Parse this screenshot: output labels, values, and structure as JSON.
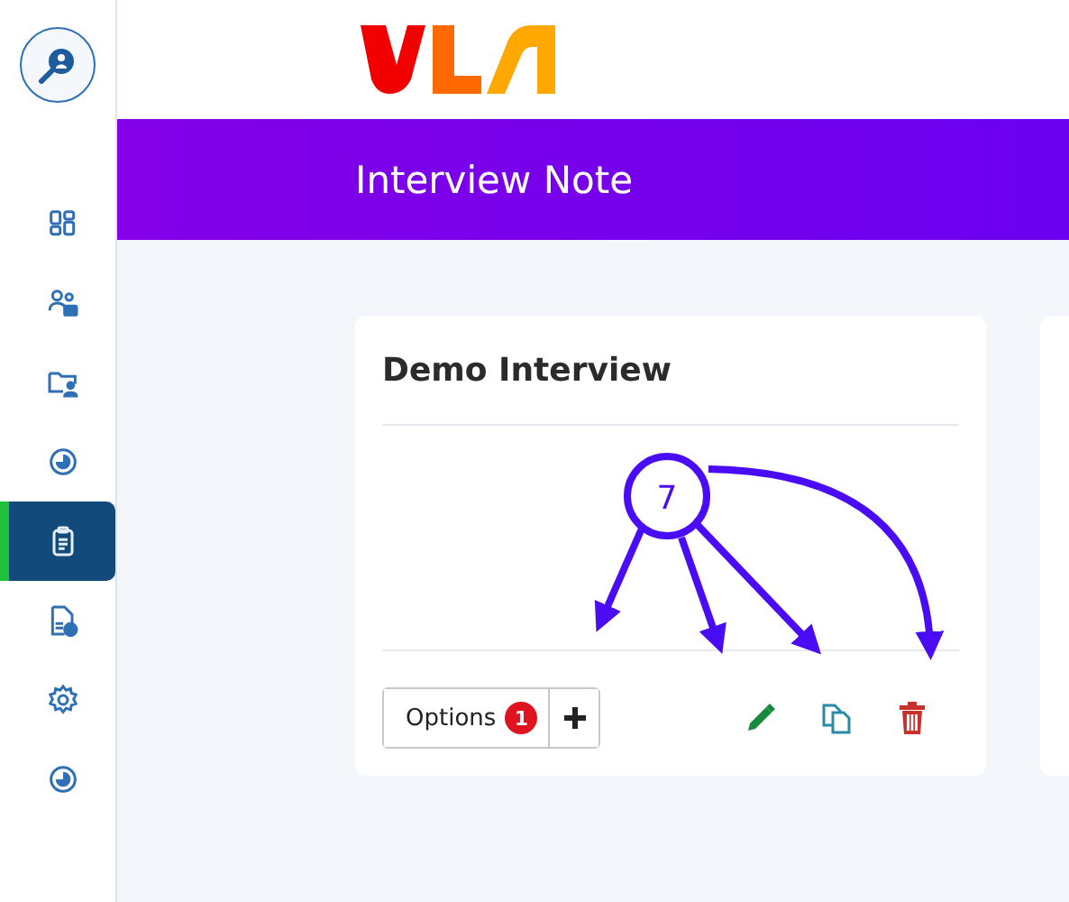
{
  "sidebar": {
    "items": [
      {
        "selected": false
      },
      {
        "selected": false
      },
      {
        "selected": false
      },
      {
        "selected": false
      },
      {
        "selected": true
      },
      {
        "selected": false
      },
      {
        "selected": false
      },
      {
        "selected": false
      }
    ]
  },
  "page_title": "Interview Note",
  "cards": [
    {
      "title": "Demo Interview",
      "options_label": "Options",
      "options_count": "1"
    }
  ],
  "callout": {
    "label": "7"
  }
}
